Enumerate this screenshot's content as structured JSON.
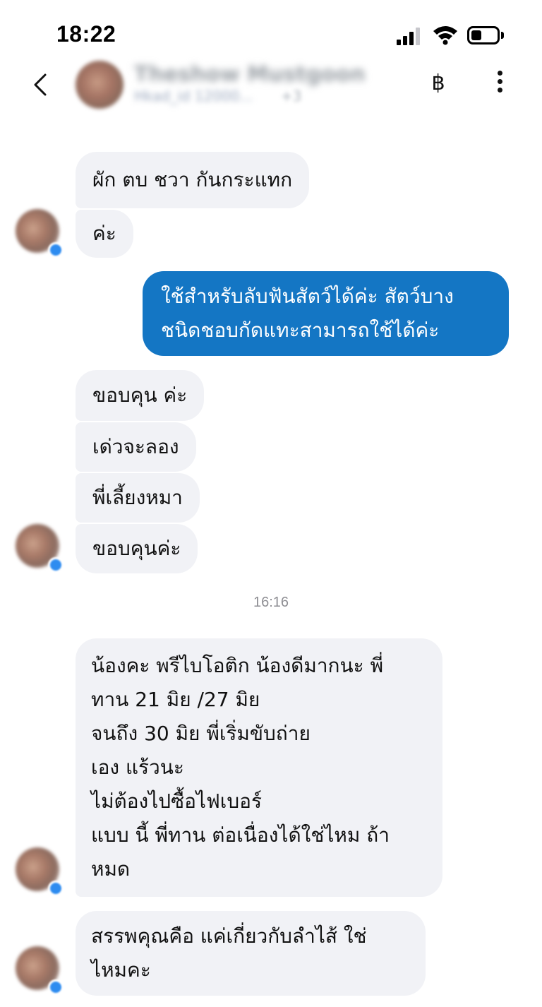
{
  "status_bar": {
    "time": "18:22",
    "icons": [
      "cellular-signal-icon",
      "wifi-icon",
      "battery-icon"
    ]
  },
  "header": {
    "back_icon": "chevron-left-icon",
    "contact_name": "Theshow Mustgoon",
    "contact_sub": "Hkad_id 12000...",
    "contact_sub_count": "+3",
    "currency_icon": "baht-icon",
    "currency_symbol": "฿",
    "more_icon": "vertical-dots-icon"
  },
  "messages": {
    "m1": {
      "direction": "in",
      "lines": [
        "ผัก ตบ ชวา กันกระแทก"
      ]
    },
    "m2": {
      "direction": "in",
      "lines": [
        "ค่ะ"
      ]
    },
    "m3": {
      "direction": "out",
      "lines": [
        "ใช้สำหรับลับฟันสัตว์ได้ค่ะ สัตว์บาง",
        "ชนิดชอบกัดแทะสามารถใช้ได้ค่ะ"
      ]
    },
    "m4": {
      "direction": "in",
      "lines": [
        "ขอบคุน ค่ะ"
      ]
    },
    "m5": {
      "direction": "in",
      "lines": [
        "เด่วจะลอง"
      ]
    },
    "m6": {
      "direction": "in",
      "lines": [
        "พี่เลี้ยงหมา"
      ]
    },
    "m7": {
      "direction": "in",
      "lines": [
        "ขอบคุนค่ะ"
      ]
    },
    "timestamp": "16:16",
    "m8": {
      "direction": "in",
      "lines": [
        "น้องคะ พรีไบโอติก น้องดีมากนะ พี่",
        "ทาน 21 มิย  /27 มิย",
        "จนถึง 30 มิย  พี่เริ่มขับถ่าย",
        "เอง แร้วนะ",
        "ไม่ต้องไปซื้อไฟเบอร์",
        "แบบ นี้ พี่ทาน ต่อเนื่องได้ใช่ไหม ถ้า",
        "หมด"
      ]
    },
    "m9": {
      "direction": "in",
      "lines": [
        "สรรพคุณคือ  แค่เกี่ยวกับลำไส้ ใช่",
        "ไหมคะ"
      ]
    }
  },
  "colors": {
    "outgoing_bubble": "#1476c4",
    "incoming_bubble": "#f1f2f6",
    "timestamp_text": "#8e8e93"
  }
}
